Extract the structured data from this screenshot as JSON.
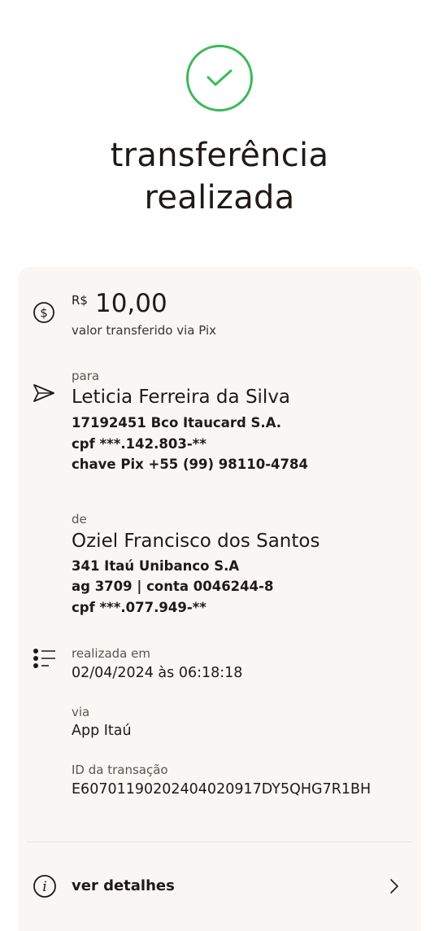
{
  "header": {
    "title_line1": "transferência",
    "title_line2": "realizada"
  },
  "amount": {
    "currency": "R$",
    "value": "10,00",
    "caption": "valor transferido via Pix"
  },
  "recipient": {
    "label": "para",
    "name": "Leticia Ferreira da Silva",
    "bank": "17192451 Bco Itaucard S.A.",
    "cpf": "cpf ***.142.803-**",
    "pix_key": "chave Pix +55 (99) 98110-4784"
  },
  "sender": {
    "label": "de",
    "name": "Oziel Francisco dos Santos",
    "bank": "341 Itaú Unibanco S.A",
    "account": "ag 3709 | conta 0046244-8",
    "cpf": "cpf ***.077.949-**"
  },
  "transaction": {
    "date_label": "realizada em",
    "date_value": "02/04/2024 às 06:18:18",
    "via_label": "via",
    "via_value": "App Itaú",
    "id_label": "ID da transação",
    "id_value": "E60701190202404020917DY5QHG7R1BH"
  },
  "footer": {
    "details_label": "ver detalhes"
  },
  "colors": {
    "success": "#3cb95a",
    "card_bg": "#f9f6f3",
    "text": "#1f1a17"
  },
  "icons": [
    "check-icon",
    "dollar-coin-icon",
    "send-icon",
    "list-icon",
    "info-icon",
    "chevron-right-icon"
  ]
}
